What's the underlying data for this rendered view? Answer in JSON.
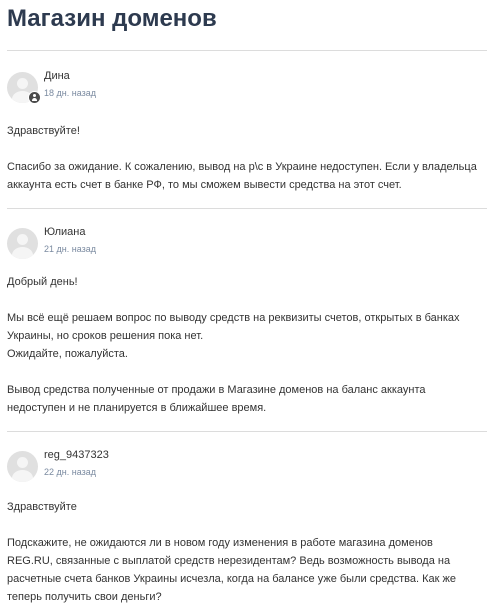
{
  "page": {
    "title": "Магазин доменов"
  },
  "comments": [
    {
      "author": "Дина",
      "time": "18 дн. назад",
      "paragraphs": [
        "Здравствуйте!",
        "Спасибо за ожидание. К сожалению, вывод на р\\с в Украине недоступен. Если у владельца аккаунта есть счет в банке РФ, то мы сможем вывести средства на этот счет."
      ]
    },
    {
      "author": "Юлиана",
      "time": "21 дн. назад",
      "paragraphs": [
        "Добрый день!",
        "Мы всё ещё решаем вопрос по выводу средств на реквизиты счетов, открытых в банках Украины, но сроков решения пока нет.",
        "Ожидайте, пожалуйста.",
        "Вывод средства полученные от продажи в Магазине доменов на баланс аккаунта недоступен и не планируется в ближайшее время."
      ]
    },
    {
      "author": "reg_9437323",
      "time": "22 дн. назад",
      "paragraphs": [
        "Здравствуйте",
        "Подскажите, не ожидаются ли в новом году изменения в работе магазина доменов REG.RU, связанные с выплатой средств нерезидентам? Ведь возможность вывода на расчетные счета банков Украины исчезла, когда на балансе уже были средства. Как же теперь получить свои деньги?"
      ]
    }
  ]
}
